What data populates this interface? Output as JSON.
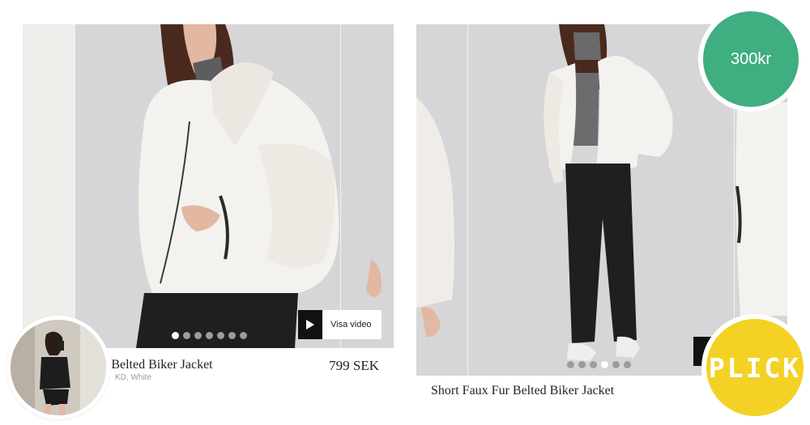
{
  "left_card": {
    "product_name": "r Belted Biker Jacket",
    "brand_color": "KD, White",
    "price": "799 SEK",
    "video_button_label": "Visa video",
    "carousel": {
      "count": 7,
      "active": 0
    }
  },
  "right_card": {
    "product_name": "Short Faux Fur Belted Biker Jacket",
    "carousel": {
      "count": 6,
      "active": 3
    }
  },
  "seller_price_badge": "300kr",
  "plick_button_label": "PLICK",
  "colors": {
    "price_badge": "#3fae80",
    "plick_button": "#f3d225",
    "photo_background": "#d6d6d8",
    "jacket": "#f4f2ee",
    "jeans": "#1f1f21"
  }
}
